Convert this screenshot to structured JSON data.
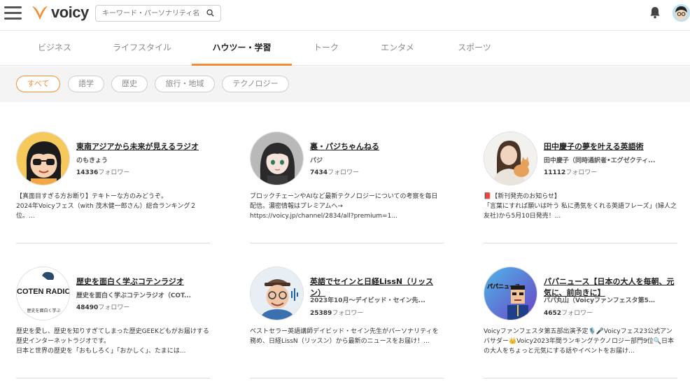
{
  "header": {
    "logo_text": "voicy",
    "search_placeholder": "キーワード・パーソナリティ名"
  },
  "tabs": [
    {
      "label": "ビジネス"
    },
    {
      "label": "ライフスタイル"
    },
    {
      "label": "ハウツー・学習",
      "active": true
    },
    {
      "label": "トーク"
    },
    {
      "label": "エンタメ"
    },
    {
      "label": "スポーツ"
    }
  ],
  "filters": [
    {
      "label": "すべて",
      "active": true
    },
    {
      "label": "語学"
    },
    {
      "label": "歴史"
    },
    {
      "label": "旅行・地域"
    },
    {
      "label": "テクノロジー"
    }
  ],
  "follower_suffix": "フォロワー",
  "channels": [
    {
      "title": "東南アジアから未来が見えるラジオ",
      "owner": "のもきょう",
      "followers": "14336",
      "desc": "【真面目すぎる方お断り】テキトーな方のみどうぞ。\n2024年Voicyフェス（with 茂木健一郎さん）総合ランキング２位。..."
    },
    {
      "title": "裏・パジちゃんねる",
      "owner": "パジ",
      "followers": "7434",
      "desc": "ブロックチェーンやAIなど最新テクノロジーについての考察を毎日配信。濃密情報はプレミアムへ→\nhttps://voicy.jp/channel/2834/all?premium=1..."
    },
    {
      "title": "田中慶子の夢を叶える英語術",
      "owner": "田中慶子（同時通訳者•エグゼクティ...",
      "followers": "11112",
      "desc": "📕【新刊発売のお知らせ】\n「言葉にすれば願いは叶う 私に勇気をくれる英語フレーズ」(婦人之友社)から5月10日発売！..."
    },
    {
      "title": "歴史を面白く学ぶコテンラジオ",
      "owner": "歴史を面白く学ぶコテンラジオ（COT...",
      "followers": "48490",
      "desc": "歴史を愛し、歴史を知りすぎてしまった歴史GEEKどもがお届けする歴史インターネットラジオです。\n日本と世界の歴史を「おもしろく」「おかしく」、たまには..."
    },
    {
      "title": "英語でセインと日経LissN（リッスン）",
      "owner": "2023年10月～デイビッド・セイン先...",
      "followers": "25389",
      "desc": "ベストセラー英語講師デイビッド・セイン先生がパーソナリティを務め、日経LissN（リッスン）から最新のニュースをお届け！..."
    },
    {
      "title": "パパニュース【日本の大人を毎朝、元気に、前向きに】",
      "owner": "パパ丸山（Voicyファンフェスタ第5部...",
      "followers": "4652",
      "desc": "Voicyファンフェスタ第五部出演予定🎙️🎤Voicyフェス23公式アンバサダー👑Voicy2023年間ランキングテクノロジー部門9位🔍日本の大人をちょっと元気にする話やイベントをお届け..."
    }
  ],
  "avatar_texts": {
    "coten_logo": "COTEN RADIO",
    "coten_sub": "歴史を面白く学ぶ",
    "papa_banner": "パパニュース"
  },
  "colors": {
    "accent": "#f28d36",
    "tab_active": "#222222",
    "chip_border": "#cfcfcf"
  }
}
